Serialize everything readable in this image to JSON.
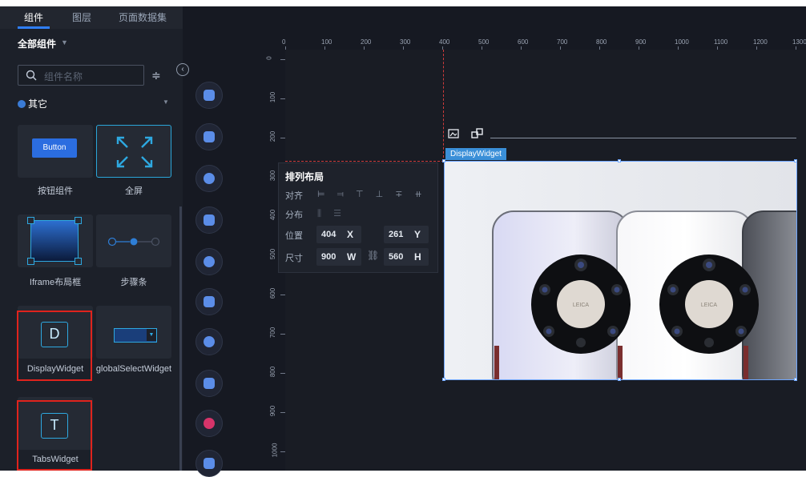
{
  "left_panel": {
    "tabs": [
      {
        "label": "组件",
        "active": true
      },
      {
        "label": "图层",
        "active": false
      },
      {
        "label": "页面数据集",
        "active": false
      }
    ],
    "filter_label": "全部组件",
    "search_placeholder": "组件名称",
    "category_label": "其它",
    "components": [
      {
        "label": "按钮组件",
        "preview": "Button",
        "highlighted": false
      },
      {
        "label": "全屏",
        "preview": "",
        "highlighted": false
      },
      {
        "label": "Iframe布局框",
        "preview": "",
        "highlighted": false
      },
      {
        "label": "步骤条",
        "preview": "",
        "highlighted": false
      },
      {
        "label": "DisplayWidget",
        "preview": "D",
        "highlighted": true
      },
      {
        "label": "globalSelectWidget",
        "preview": "",
        "highlighted": false
      },
      {
        "label": "TabsWidget",
        "preview": "T",
        "highlighted": true
      }
    ]
  },
  "ruler": {
    "top_ticks": [
      "0",
      "100",
      "200",
      "300",
      "400",
      "500",
      "600",
      "700",
      "800",
      "900",
      "1000",
      "1100",
      "1200",
      "1300"
    ],
    "left_ticks": [
      "0",
      "100",
      "200",
      "300",
      "400",
      "500",
      "600",
      "700",
      "800",
      "900",
      "1000"
    ]
  },
  "widget": {
    "tag": "DisplayWidget",
    "image_caption": "LEICA"
  },
  "properties": {
    "title": "排列布局",
    "align_label": "对齐",
    "distribute_label": "分布",
    "position_label": "位置",
    "size_label": "尺寸",
    "x_value": "404",
    "x_unit": "X",
    "y_value": "261",
    "y_unit": "Y",
    "w_value": "900",
    "w_unit": "W",
    "h_value": "560",
    "h_unit": "H"
  },
  "colors": {
    "accent": "#2f7ef7",
    "highlight_border": "#e0231d",
    "widget_tag": "#3a8fd8"
  },
  "icons": [
    "search-icon",
    "sort-icon",
    "collapse-icon",
    "fullscreen-icon",
    "image-icon",
    "link-icon"
  ]
}
